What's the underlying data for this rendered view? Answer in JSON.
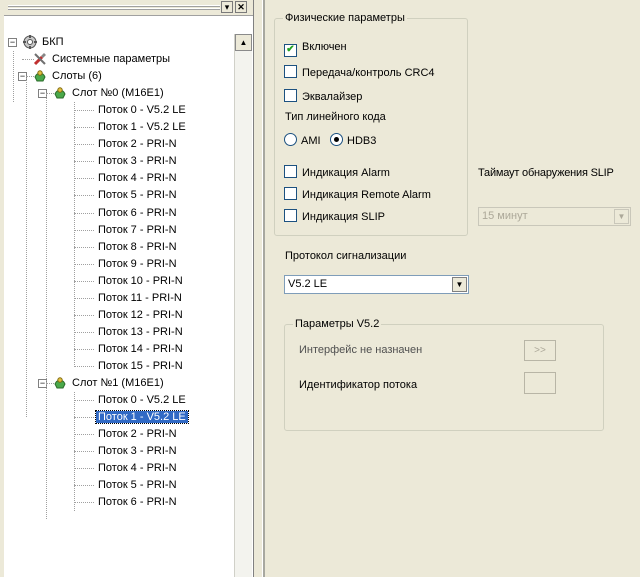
{
  "tree": {
    "nodes": [
      {
        "label": "БКП",
        "depth": 0,
        "expander": "minus",
        "icon": "gear-icon"
      },
      {
        "label": "Системные параметры",
        "depth": 1,
        "icon": "tools-icon"
      },
      {
        "label": "Слоты (6)",
        "depth": 1,
        "expander": "minus",
        "icon": "slot-icon"
      },
      {
        "label": "Слот №0 (M16E1)",
        "depth": 2,
        "expander": "minus",
        "icon": "slot-icon"
      },
      {
        "label": "Поток 0 - V5.2 LE",
        "depth": 3
      },
      {
        "label": "Поток 1 - V5.2 LE",
        "depth": 3
      },
      {
        "label": "Поток 2 - PRI-N",
        "depth": 3
      },
      {
        "label": "Поток 3 - PRI-N",
        "depth": 3
      },
      {
        "label": "Поток 4 - PRI-N",
        "depth": 3
      },
      {
        "label": "Поток 5 - PRI-N",
        "depth": 3
      },
      {
        "label": "Поток 6 - PRI-N",
        "depth": 3
      },
      {
        "label": "Поток 7 - PRI-N",
        "depth": 3
      },
      {
        "label": "Поток 8 - PRI-N",
        "depth": 3
      },
      {
        "label": "Поток 9 - PRI-N",
        "depth": 3
      },
      {
        "label": "Поток 10 - PRI-N",
        "depth": 3
      },
      {
        "label": "Поток 11 - PRI-N",
        "depth": 3
      },
      {
        "label": "Поток 12 - PRI-N",
        "depth": 3
      },
      {
        "label": "Поток 13 - PRI-N",
        "depth": 3
      },
      {
        "label": "Поток 14 - PRI-N",
        "depth": 3
      },
      {
        "label": "Поток 15 - PRI-N",
        "depth": 3
      },
      {
        "label": "Слот №1 (M16E1)",
        "depth": 2,
        "expander": "minus",
        "icon": "slot-icon"
      },
      {
        "label": "Поток 0 - V5.2 LE",
        "depth": 3
      },
      {
        "label": "Поток 1 - V5.2 LE",
        "depth": 3,
        "selected": true
      },
      {
        "label": "Поток 2 - PRI-N",
        "depth": 3
      },
      {
        "label": "Поток 3 - PRI-N",
        "depth": 3
      },
      {
        "label": "Поток 4 - PRI-N",
        "depth": 3
      },
      {
        "label": "Поток 5 - PRI-N",
        "depth": 3
      },
      {
        "label": "Поток 6 - PRI-N",
        "depth": 3
      }
    ]
  },
  "physical": {
    "legend": "Физические параметры",
    "enabled_label": "Включен",
    "enabled": true,
    "crc4_label": "Передача/контроль CRC4",
    "crc4": false,
    "equalizer_label": "Эквалайзер",
    "equalizer": false,
    "line_code_label": "Тип линейного кода",
    "ami_label": "AMI",
    "hdb3_label": "HDB3",
    "line_code_selected": "HDB3",
    "alarm_label": "Индикация Alarm",
    "alarm": false,
    "remote_alarm_label": "Индикация Remote Alarm",
    "remote_alarm": false,
    "slip_label": "Индикация SLIP",
    "slip": false
  },
  "slip_timeout": {
    "label": "Таймаут обнаружения SLIP",
    "value": "15 минут",
    "enabled": false
  },
  "protocol": {
    "label": "Протокол сигнализации",
    "value": "V5.2 LE"
  },
  "v52": {
    "legend": "Параметры V5.2",
    "interface_label": "Интерфейс не назначен",
    "assign_button": ">>",
    "stream_id_label": "Идентификатор потока"
  },
  "colors": {
    "selection": "#316ac5",
    "checkmark": "#21a121",
    "panel_bg": "#ece9d8"
  }
}
